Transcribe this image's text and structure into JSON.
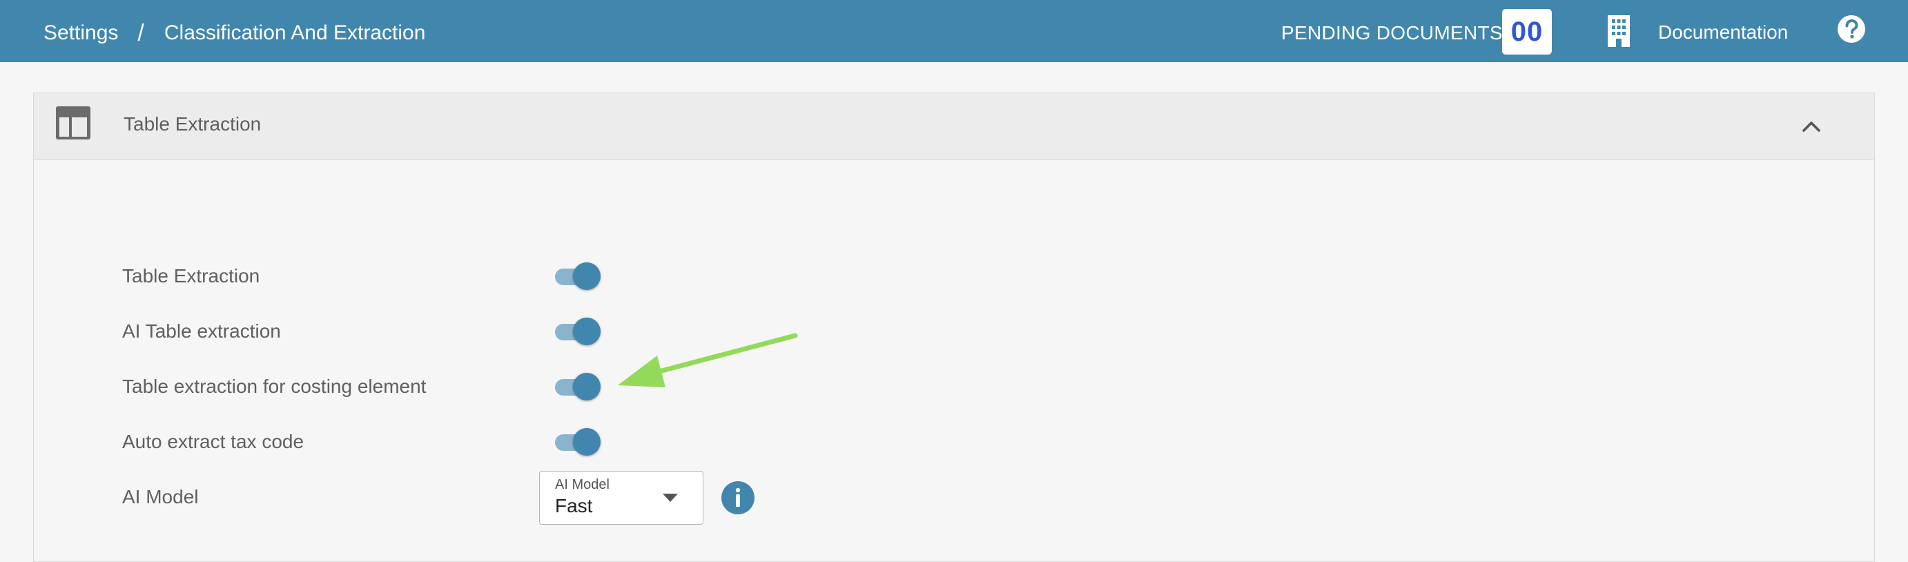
{
  "header": {
    "breadcrumb": {
      "root": "Settings",
      "separator": "/",
      "current": "Classification And Extraction"
    },
    "pending_label": "PENDING DOCUMENTS:",
    "pending_count": "00",
    "building_icon": "building-icon",
    "documentation_label": "Documentation",
    "help_icon": "help-icon"
  },
  "panel": {
    "title": "Table Extraction",
    "icon": "table-icon",
    "collapse_icon": "chevron-up-icon",
    "settings": [
      {
        "label": "Table Extraction",
        "enabled": true
      },
      {
        "label": "AI Table extraction",
        "enabled": true
      },
      {
        "label": "Table extraction for costing element",
        "enabled": true
      },
      {
        "label": "Auto extract tax code",
        "enabled": true
      }
    ],
    "ai_model": {
      "label": "AI Model",
      "field_label": "AI Model",
      "value": "Fast",
      "info_icon": "info-icon"
    }
  },
  "colors": {
    "header_bg": "#4186ad",
    "accent": "#4186ad",
    "toggle_track": "#8ab3cc",
    "pending_count_text": "#2f57d8",
    "annotation_arrow": "#93da5a"
  }
}
